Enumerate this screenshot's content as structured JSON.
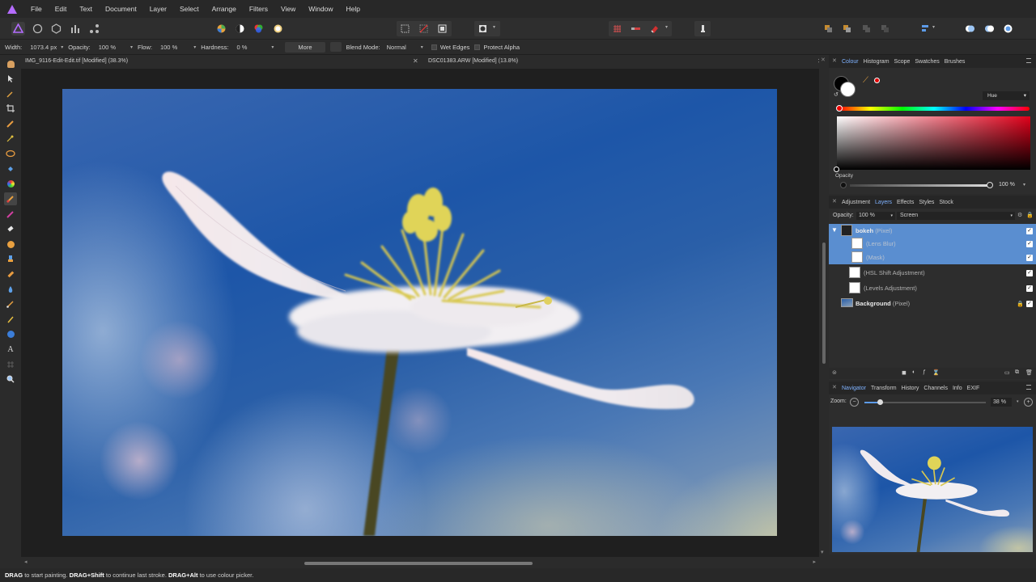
{
  "menu": [
    "File",
    "Edit",
    "Text",
    "Document",
    "Layer",
    "Select",
    "Arrange",
    "Filters",
    "View",
    "Window",
    "Help"
  ],
  "context": {
    "width_label": "Width:",
    "width_value": "1073.4 px",
    "opacity_label": "Opacity:",
    "opacity_value": "100 %",
    "flow_label": "Flow:",
    "flow_value": "100 %",
    "hardness_label": "Hardness:",
    "hardness_value": "0 %",
    "more_label": "More",
    "blend_label": "Blend Mode:",
    "blend_value": "Normal",
    "wet_edges": "Wet Edges",
    "protect_alpha": "Protect Alpha"
  },
  "tabs": {
    "doc1": "IMG_9116-Edit-Edit.tif [Modified] (38.3%)",
    "doc2": "DSC01383.ARW [Modified] (13.8%)"
  },
  "colour_panel": {
    "tabs": [
      "Colour",
      "Histogram",
      "Scope",
      "Swatches",
      "Brushes"
    ],
    "mode": "Hue",
    "opacity_label": "Opacity",
    "opacity_value": "100 %",
    "accent": "#e00000"
  },
  "layers_panel": {
    "tabs": [
      "Adjustment",
      "Layers",
      "Effects",
      "Styles",
      "Stock"
    ],
    "opacity_label": "Opacity:",
    "opacity_value": "100 %",
    "blend_mode": "Screen",
    "layers": [
      {
        "name": "bokeh",
        "type": "(Pixel)",
        "selected": true
      },
      {
        "name": "",
        "type": "(Lens Blur)",
        "selected": true
      },
      {
        "name": "",
        "type": "(Mask)",
        "selected": true
      },
      {
        "name": "",
        "type": "(HSL Shift Adjustment)",
        "selected": false
      },
      {
        "name": "",
        "type": "(Levels Adjustment)",
        "selected": false
      },
      {
        "name": "Background",
        "type": "(Pixel)",
        "selected": false
      }
    ],
    "selection_color": "#5a8ed0"
  },
  "navigator_panel": {
    "tabs": [
      "Navigator",
      "Transform",
      "History",
      "Channels",
      "Info",
      "EXIF"
    ],
    "zoom_label": "Zoom:",
    "zoom_value": "38 %"
  },
  "status": {
    "key1": "DRAG",
    "text1": "to start painting.",
    "key2": "DRAG+Shift",
    "text2": "to continue last stroke.",
    "key3": "DRAG+Alt",
    "text3": "to use colour picker."
  }
}
